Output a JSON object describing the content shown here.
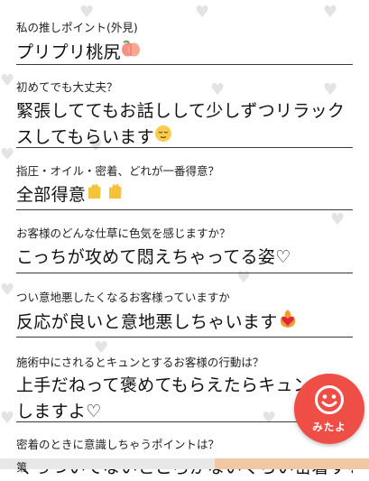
{
  "qa": [
    {
      "question": "私の推しポイント(外見)",
      "answer": "プリプリ桃尻",
      "icon": "peach-icon"
    },
    {
      "question": "初めてでも大丈夫？",
      "answer": "緊張しててもお話しして少しずつリラックスしてもらいます",
      "icon": "relieved-face-icon"
    },
    {
      "question": "指圧・オイル・密着、どれが一番得意？",
      "answer": "全部得意",
      "icon": "raised-hands-icon"
    },
    {
      "question": "お客様のどんな仕草に色気を感じますか？",
      "answer": "こっちが攻めて悶えちゃってる姿♡",
      "icon": ""
    },
    {
      "question": "つい意地悪したくなるお客様っていますか",
      "answer": "反応が良いと意地悪しちゃいます",
      "icon": "heart-on-fire-icon"
    },
    {
      "question": "施術中にされるとキュンとするお客様の行動は？",
      "answer": "上手だねって褒めてもらえたらキュンッてしますよ♡",
      "icon": ""
    },
    {
      "question": "密着のときに意識しちゃうポイントは？",
      "answer": "くっついてないところがないぐらい密着する",
      "icon": ""
    }
  ],
  "fab": {
    "label": "みたよ",
    "icon": "smiley-icon"
  },
  "cut_text": "第"
}
